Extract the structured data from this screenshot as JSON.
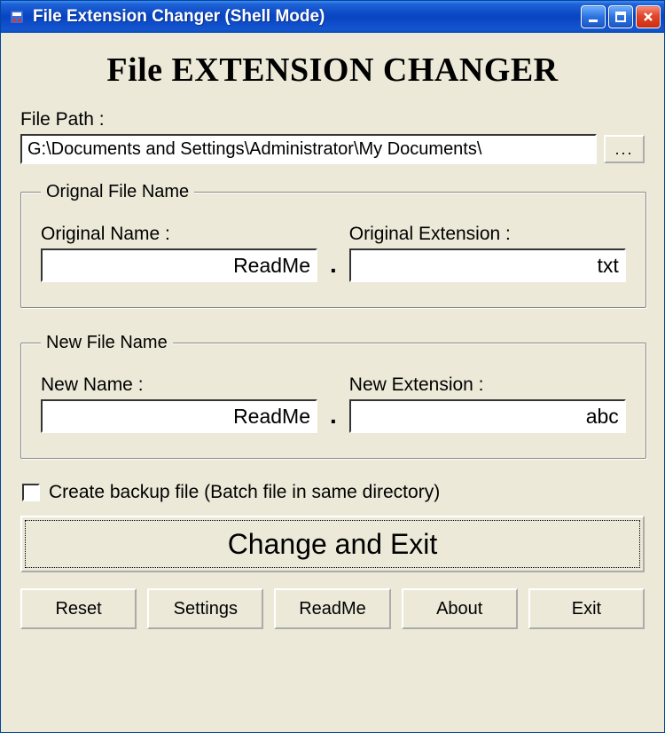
{
  "window": {
    "title": "File Extension Changer (Shell Mode)"
  },
  "heading": "File EXTENSION CHANGER",
  "filepath": {
    "label": "File Path :",
    "value": "G:\\Documents and Settings\\Administrator\\My Documents\\",
    "browse": "..."
  },
  "original": {
    "legend": "Orignal File Name",
    "name_label": "Original Name :",
    "name_value": "ReadMe",
    "ext_label": "Original Extension :",
    "ext_value": "txt"
  },
  "newfile": {
    "legend": "New File Name",
    "name_label": "New Name :",
    "name_value": "ReadMe",
    "ext_label": "New Extension :",
    "ext_value": "abc"
  },
  "dot": ".",
  "backup": {
    "checked": false,
    "label": "Create backup file (Batch file in same directory)"
  },
  "actions": {
    "change_exit": "Change and Exit",
    "reset": "Reset",
    "settings": "Settings",
    "readme": "ReadMe",
    "about": "About",
    "exit": "Exit"
  }
}
